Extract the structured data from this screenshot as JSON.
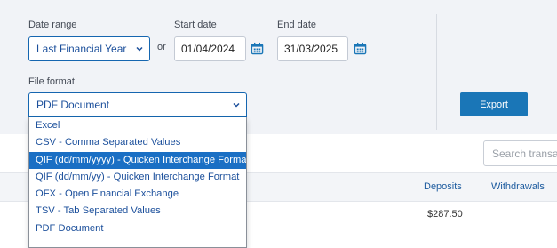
{
  "filters": {
    "date_range_label": "Date range",
    "date_range_value": "Last Financial Year",
    "or_text": "or",
    "start_date_label": "Start date",
    "start_date_value": "01/04/2024",
    "end_date_label": "End date",
    "end_date_value": "31/03/2025",
    "file_format_label": "File format",
    "file_format_value": "PDF Document",
    "export_label": "Export"
  },
  "file_format_options": [
    {
      "label": "Excel",
      "selected": false
    },
    {
      "label": "CSV - Comma Separated Values",
      "selected": false
    },
    {
      "label": "QIF (dd/mm/yyyy) - Quicken Interchange Format",
      "selected": true
    },
    {
      "label": "QIF (dd/mm/yy) - Quicken Interchange Format",
      "selected": false
    },
    {
      "label": "OFX - Open Financial Exchange",
      "selected": false
    },
    {
      "label": "TSV - Tab Separated Values",
      "selected": false
    },
    {
      "label": "PDF Document",
      "selected": false
    }
  ],
  "search": {
    "placeholder": "Search transactions"
  },
  "table": {
    "headers": {
      "deposits": "Deposits",
      "withdrawals": "Withdrawals"
    },
    "rows": [
      {
        "deposits": "$287.50",
        "withdrawals": ""
      }
    ]
  },
  "colors": {
    "accent": "#1a76b7",
    "panel_bg": "#f1f3f7",
    "link_text": "#1b4f9b",
    "highlight": "#1a6fc4"
  },
  "icons": {
    "select_chevron": "chevron-down-icon",
    "date_picker": "calendar-icon"
  }
}
